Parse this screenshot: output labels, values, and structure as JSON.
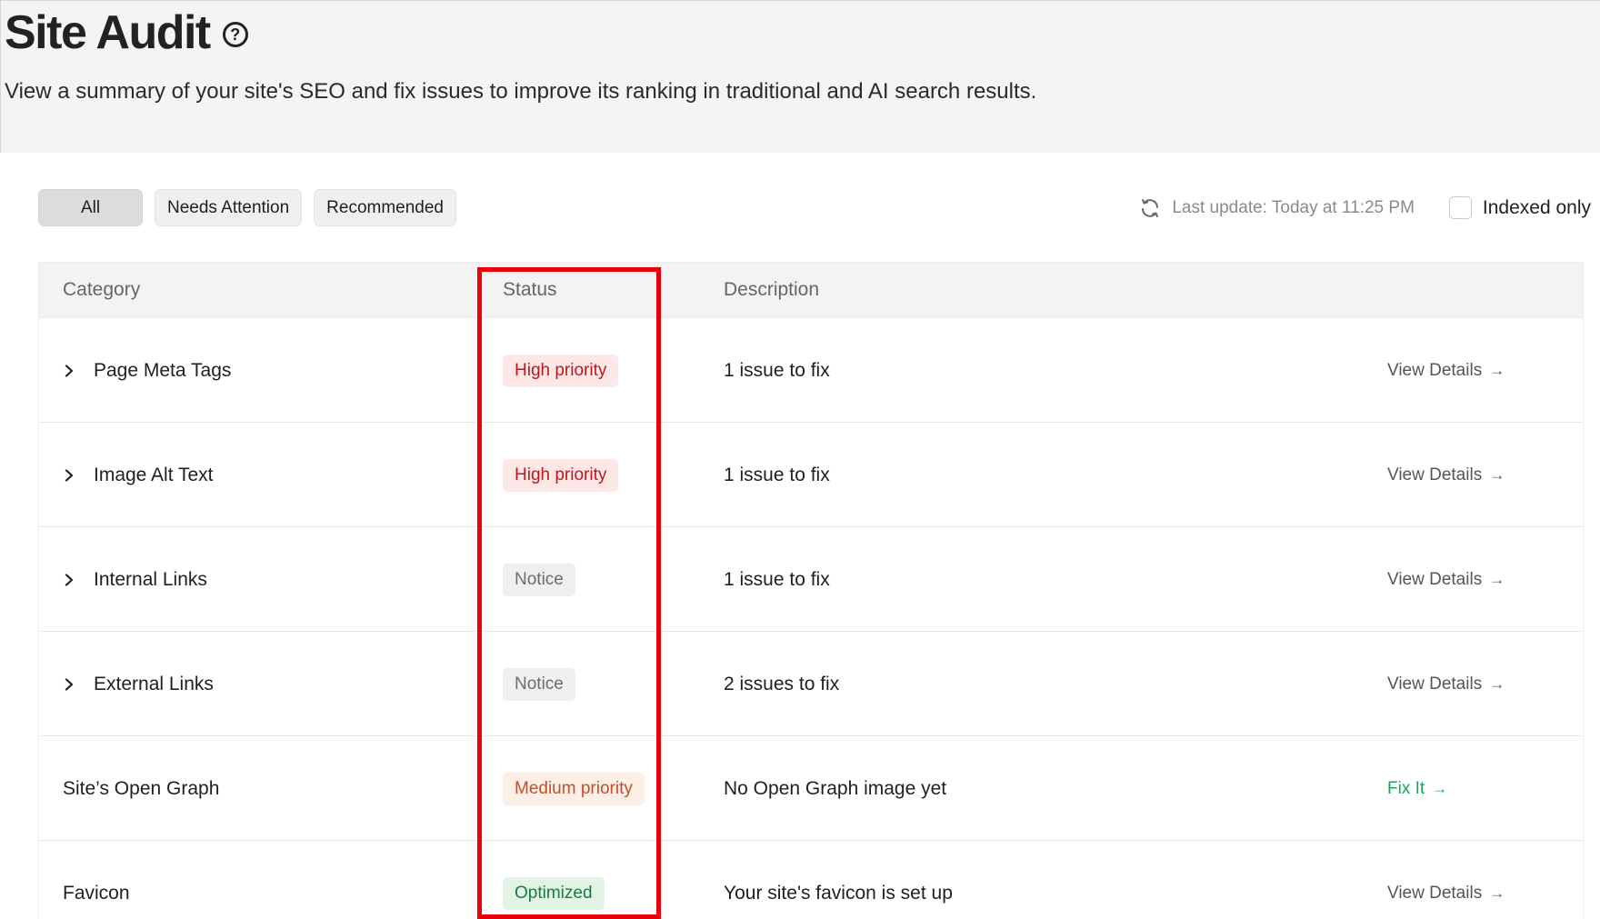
{
  "header": {
    "title": "Site Audit",
    "help_icon": "?",
    "subtitle": "View a summary of your site's SEO and fix issues to improve its ranking in traditional and AI search results."
  },
  "filters": [
    {
      "label": "All",
      "active": true
    },
    {
      "label": "Needs Attention",
      "active": false
    },
    {
      "label": "Recommended",
      "active": false
    }
  ],
  "toolbar": {
    "last_update": "Last update: Today at 11:25 PM",
    "indexed_only_label": "Indexed only",
    "indexed_only_checked": false
  },
  "table": {
    "columns": [
      "Category",
      "Status",
      "Description"
    ],
    "rows": [
      {
        "category": "Page Meta Tags",
        "expandable": true,
        "status": "High priority",
        "status_type": "high",
        "description": "1 issue to fix",
        "action": "View Details"
      },
      {
        "category": "Image Alt Text",
        "expandable": true,
        "status": "High priority",
        "status_type": "high",
        "description": "1 issue to fix",
        "action": "View Details"
      },
      {
        "category": "Internal Links",
        "expandable": true,
        "status": "Notice",
        "status_type": "notice",
        "description": "1 issue to fix",
        "action": "View Details"
      },
      {
        "category": "External Links",
        "expandable": true,
        "status": "Notice",
        "status_type": "notice",
        "description": "2 issues to fix",
        "action": "View Details"
      },
      {
        "category": "Site’s Open Graph",
        "expandable": false,
        "status": "Medium priority",
        "status_type": "medium",
        "description": "No Open Graph image yet",
        "action": "Fix It"
      },
      {
        "category": "Favicon",
        "expandable": false,
        "status": "Optimized",
        "status_type": "optimized",
        "description": "Your site's favicon is set up",
        "action": "View Details"
      }
    ]
  },
  "colors": {
    "highlight": "#e8000b",
    "high_priority": "#c0161b",
    "medium_priority": "#c1502a",
    "optimized": "#1c7a3c",
    "fix_link": "#1aa55b"
  },
  "icons": {
    "help": "help-circle-icon",
    "refresh": "refresh-icon",
    "expand": "chevron-right-icon",
    "arrow": "arrow-right-icon"
  }
}
